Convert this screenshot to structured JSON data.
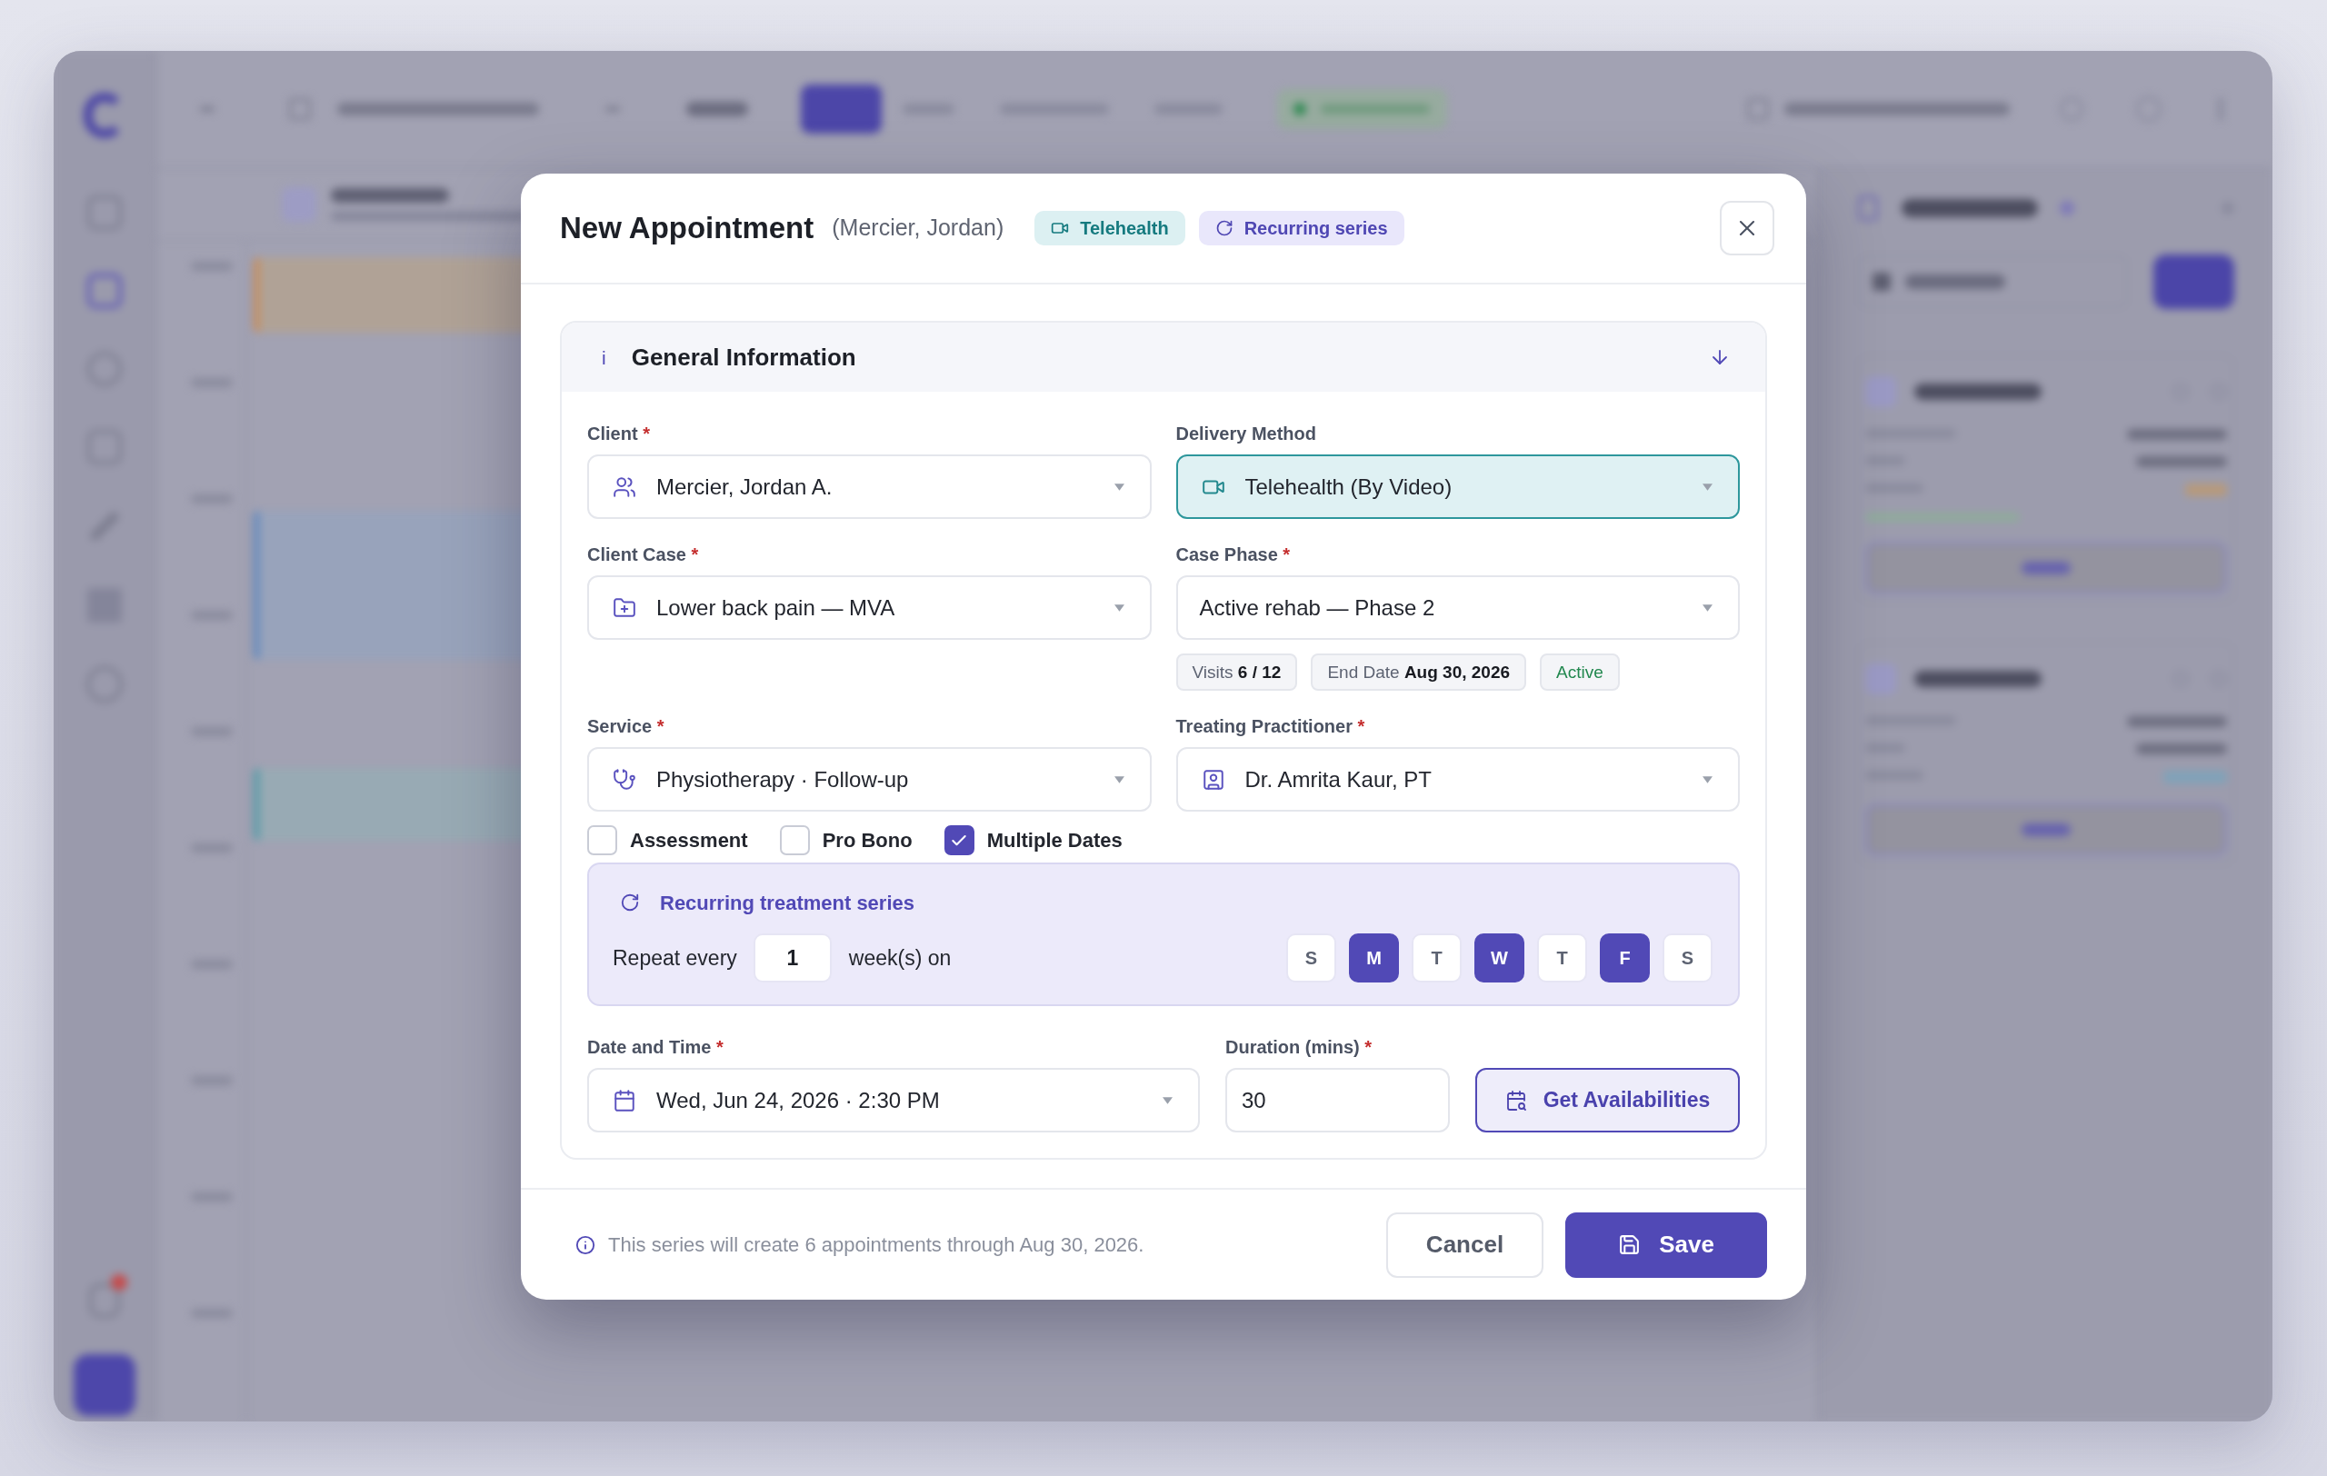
{
  "dialog": {
    "title": "New Appointment",
    "subtitle": "(Mercier, Jordan)",
    "badges": [
      {
        "kind": "telehealth",
        "label": "Telehealth"
      },
      {
        "kind": "recurring",
        "label": "Recurring series"
      }
    ]
  },
  "section": {
    "icon": "i",
    "title": "General Information"
  },
  "client": {
    "label": "Client",
    "mark": "*",
    "value": "Mercier, Jordan A."
  },
  "delivery_method": {
    "label": "Delivery Method",
    "value": "Telehealth (By Video)",
    "highlighted": true
  },
  "client_case": {
    "label": "Client Case",
    "mark": "*",
    "value": "Lower back pain — MVA"
  },
  "case_phase": {
    "label": "Case Phase",
    "mark": "*",
    "value": "Active rehab — Phase 2",
    "chips": [
      {
        "kind": "info",
        "text": "Visits **6 / 12**"
      },
      {
        "kind": "info",
        "text": "End Date **Aug 30, 2026**"
      },
      {
        "kind": "status",
        "text": "Active"
      }
    ]
  },
  "service": {
    "label": "Service",
    "mark": "*",
    "value": "Physiotherapy · Follow-up"
  },
  "practitioner": {
    "label": "Treating Practitioner",
    "mark": "*",
    "value": "Dr. Amrita Kaur, PT"
  },
  "options": [
    {
      "label": "Assessment",
      "checked": false
    },
    {
      "label": "Pro Bono",
      "checked": false
    },
    {
      "label": "Multiple Dates",
      "checked": true
    }
  ],
  "recurrence": {
    "title": "Recurring treatment series",
    "repeat_label": "Repeat every",
    "interval": "1",
    "unit_label": "week(s) on",
    "days": [
      {
        "label": "S",
        "selected": false
      },
      {
        "label": "M",
        "selected": true
      },
      {
        "label": "T",
        "selected": false
      },
      {
        "label": "W",
        "selected": true
      },
      {
        "label": "T",
        "selected": false
      },
      {
        "label": "F",
        "selected": true
      },
      {
        "label": "S",
        "selected": false
      }
    ]
  },
  "date_time": {
    "label": "Date and Time",
    "mark": "*",
    "value": "Wed, Jun 24, 2026 · 2:30 PM"
  },
  "duration": {
    "label": "Duration (mins)",
    "mark": "*",
    "value": "30"
  },
  "availability_button": "Get Availabilities",
  "footer": {
    "note": "This series will create 6 appointments through Aug 30, 2026.",
    "buttons": [
      {
        "kind": "secondary",
        "label": "Cancel"
      },
      {
        "kind": "primary",
        "label": "Save"
      }
    ]
  }
}
